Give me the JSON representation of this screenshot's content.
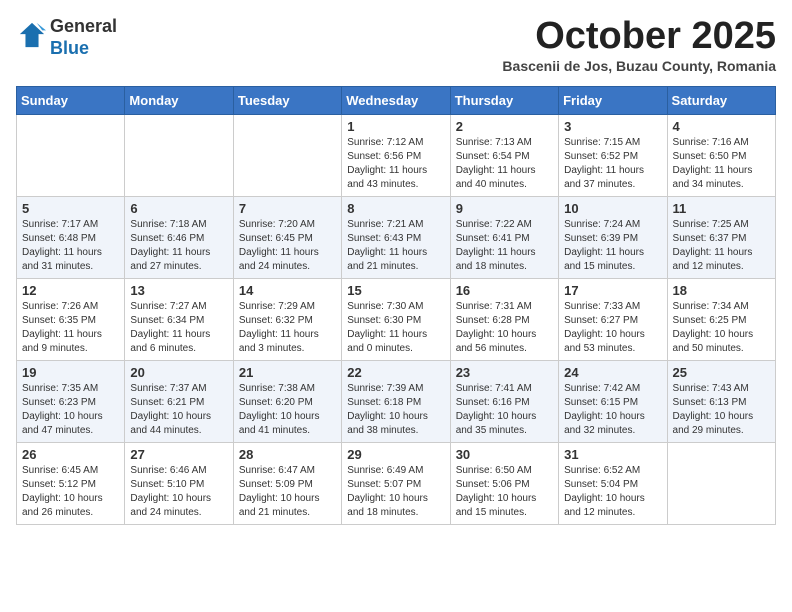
{
  "header": {
    "logo_line1": "General",
    "logo_line2": "Blue",
    "month": "October 2025",
    "location": "Bascenii de Jos, Buzau County, Romania"
  },
  "weekdays": [
    "Sunday",
    "Monday",
    "Tuesday",
    "Wednesday",
    "Thursday",
    "Friday",
    "Saturday"
  ],
  "rows": [
    [
      {
        "day": "",
        "info": ""
      },
      {
        "day": "",
        "info": ""
      },
      {
        "day": "",
        "info": ""
      },
      {
        "day": "1",
        "info": "Sunrise: 7:12 AM\nSunset: 6:56 PM\nDaylight: 11 hours and 43 minutes."
      },
      {
        "day": "2",
        "info": "Sunrise: 7:13 AM\nSunset: 6:54 PM\nDaylight: 11 hours and 40 minutes."
      },
      {
        "day": "3",
        "info": "Sunrise: 7:15 AM\nSunset: 6:52 PM\nDaylight: 11 hours and 37 minutes."
      },
      {
        "day": "4",
        "info": "Sunrise: 7:16 AM\nSunset: 6:50 PM\nDaylight: 11 hours and 34 minutes."
      }
    ],
    [
      {
        "day": "5",
        "info": "Sunrise: 7:17 AM\nSunset: 6:48 PM\nDaylight: 11 hours and 31 minutes."
      },
      {
        "day": "6",
        "info": "Sunrise: 7:18 AM\nSunset: 6:46 PM\nDaylight: 11 hours and 27 minutes."
      },
      {
        "day": "7",
        "info": "Sunrise: 7:20 AM\nSunset: 6:45 PM\nDaylight: 11 hours and 24 minutes."
      },
      {
        "day": "8",
        "info": "Sunrise: 7:21 AM\nSunset: 6:43 PM\nDaylight: 11 hours and 21 minutes."
      },
      {
        "day": "9",
        "info": "Sunrise: 7:22 AM\nSunset: 6:41 PM\nDaylight: 11 hours and 18 minutes."
      },
      {
        "day": "10",
        "info": "Sunrise: 7:24 AM\nSunset: 6:39 PM\nDaylight: 11 hours and 15 minutes."
      },
      {
        "day": "11",
        "info": "Sunrise: 7:25 AM\nSunset: 6:37 PM\nDaylight: 11 hours and 12 minutes."
      }
    ],
    [
      {
        "day": "12",
        "info": "Sunrise: 7:26 AM\nSunset: 6:35 PM\nDaylight: 11 hours and 9 minutes."
      },
      {
        "day": "13",
        "info": "Sunrise: 7:27 AM\nSunset: 6:34 PM\nDaylight: 11 hours and 6 minutes."
      },
      {
        "day": "14",
        "info": "Sunrise: 7:29 AM\nSunset: 6:32 PM\nDaylight: 11 hours and 3 minutes."
      },
      {
        "day": "15",
        "info": "Sunrise: 7:30 AM\nSunset: 6:30 PM\nDaylight: 11 hours and 0 minutes."
      },
      {
        "day": "16",
        "info": "Sunrise: 7:31 AM\nSunset: 6:28 PM\nDaylight: 10 hours and 56 minutes."
      },
      {
        "day": "17",
        "info": "Sunrise: 7:33 AM\nSunset: 6:27 PM\nDaylight: 10 hours and 53 minutes."
      },
      {
        "day": "18",
        "info": "Sunrise: 7:34 AM\nSunset: 6:25 PM\nDaylight: 10 hours and 50 minutes."
      }
    ],
    [
      {
        "day": "19",
        "info": "Sunrise: 7:35 AM\nSunset: 6:23 PM\nDaylight: 10 hours and 47 minutes."
      },
      {
        "day": "20",
        "info": "Sunrise: 7:37 AM\nSunset: 6:21 PM\nDaylight: 10 hours and 44 minutes."
      },
      {
        "day": "21",
        "info": "Sunrise: 7:38 AM\nSunset: 6:20 PM\nDaylight: 10 hours and 41 minutes."
      },
      {
        "day": "22",
        "info": "Sunrise: 7:39 AM\nSunset: 6:18 PM\nDaylight: 10 hours and 38 minutes."
      },
      {
        "day": "23",
        "info": "Sunrise: 7:41 AM\nSunset: 6:16 PM\nDaylight: 10 hours and 35 minutes."
      },
      {
        "day": "24",
        "info": "Sunrise: 7:42 AM\nSunset: 6:15 PM\nDaylight: 10 hours and 32 minutes."
      },
      {
        "day": "25",
        "info": "Sunrise: 7:43 AM\nSunset: 6:13 PM\nDaylight: 10 hours and 29 minutes."
      }
    ],
    [
      {
        "day": "26",
        "info": "Sunrise: 6:45 AM\nSunset: 5:12 PM\nDaylight: 10 hours and 26 minutes."
      },
      {
        "day": "27",
        "info": "Sunrise: 6:46 AM\nSunset: 5:10 PM\nDaylight: 10 hours and 24 minutes."
      },
      {
        "day": "28",
        "info": "Sunrise: 6:47 AM\nSunset: 5:09 PM\nDaylight: 10 hours and 21 minutes."
      },
      {
        "day": "29",
        "info": "Sunrise: 6:49 AM\nSunset: 5:07 PM\nDaylight: 10 hours and 18 minutes."
      },
      {
        "day": "30",
        "info": "Sunrise: 6:50 AM\nSunset: 5:06 PM\nDaylight: 10 hours and 15 minutes."
      },
      {
        "day": "31",
        "info": "Sunrise: 6:52 AM\nSunset: 5:04 PM\nDaylight: 10 hours and 12 minutes."
      },
      {
        "day": "",
        "info": ""
      }
    ]
  ]
}
